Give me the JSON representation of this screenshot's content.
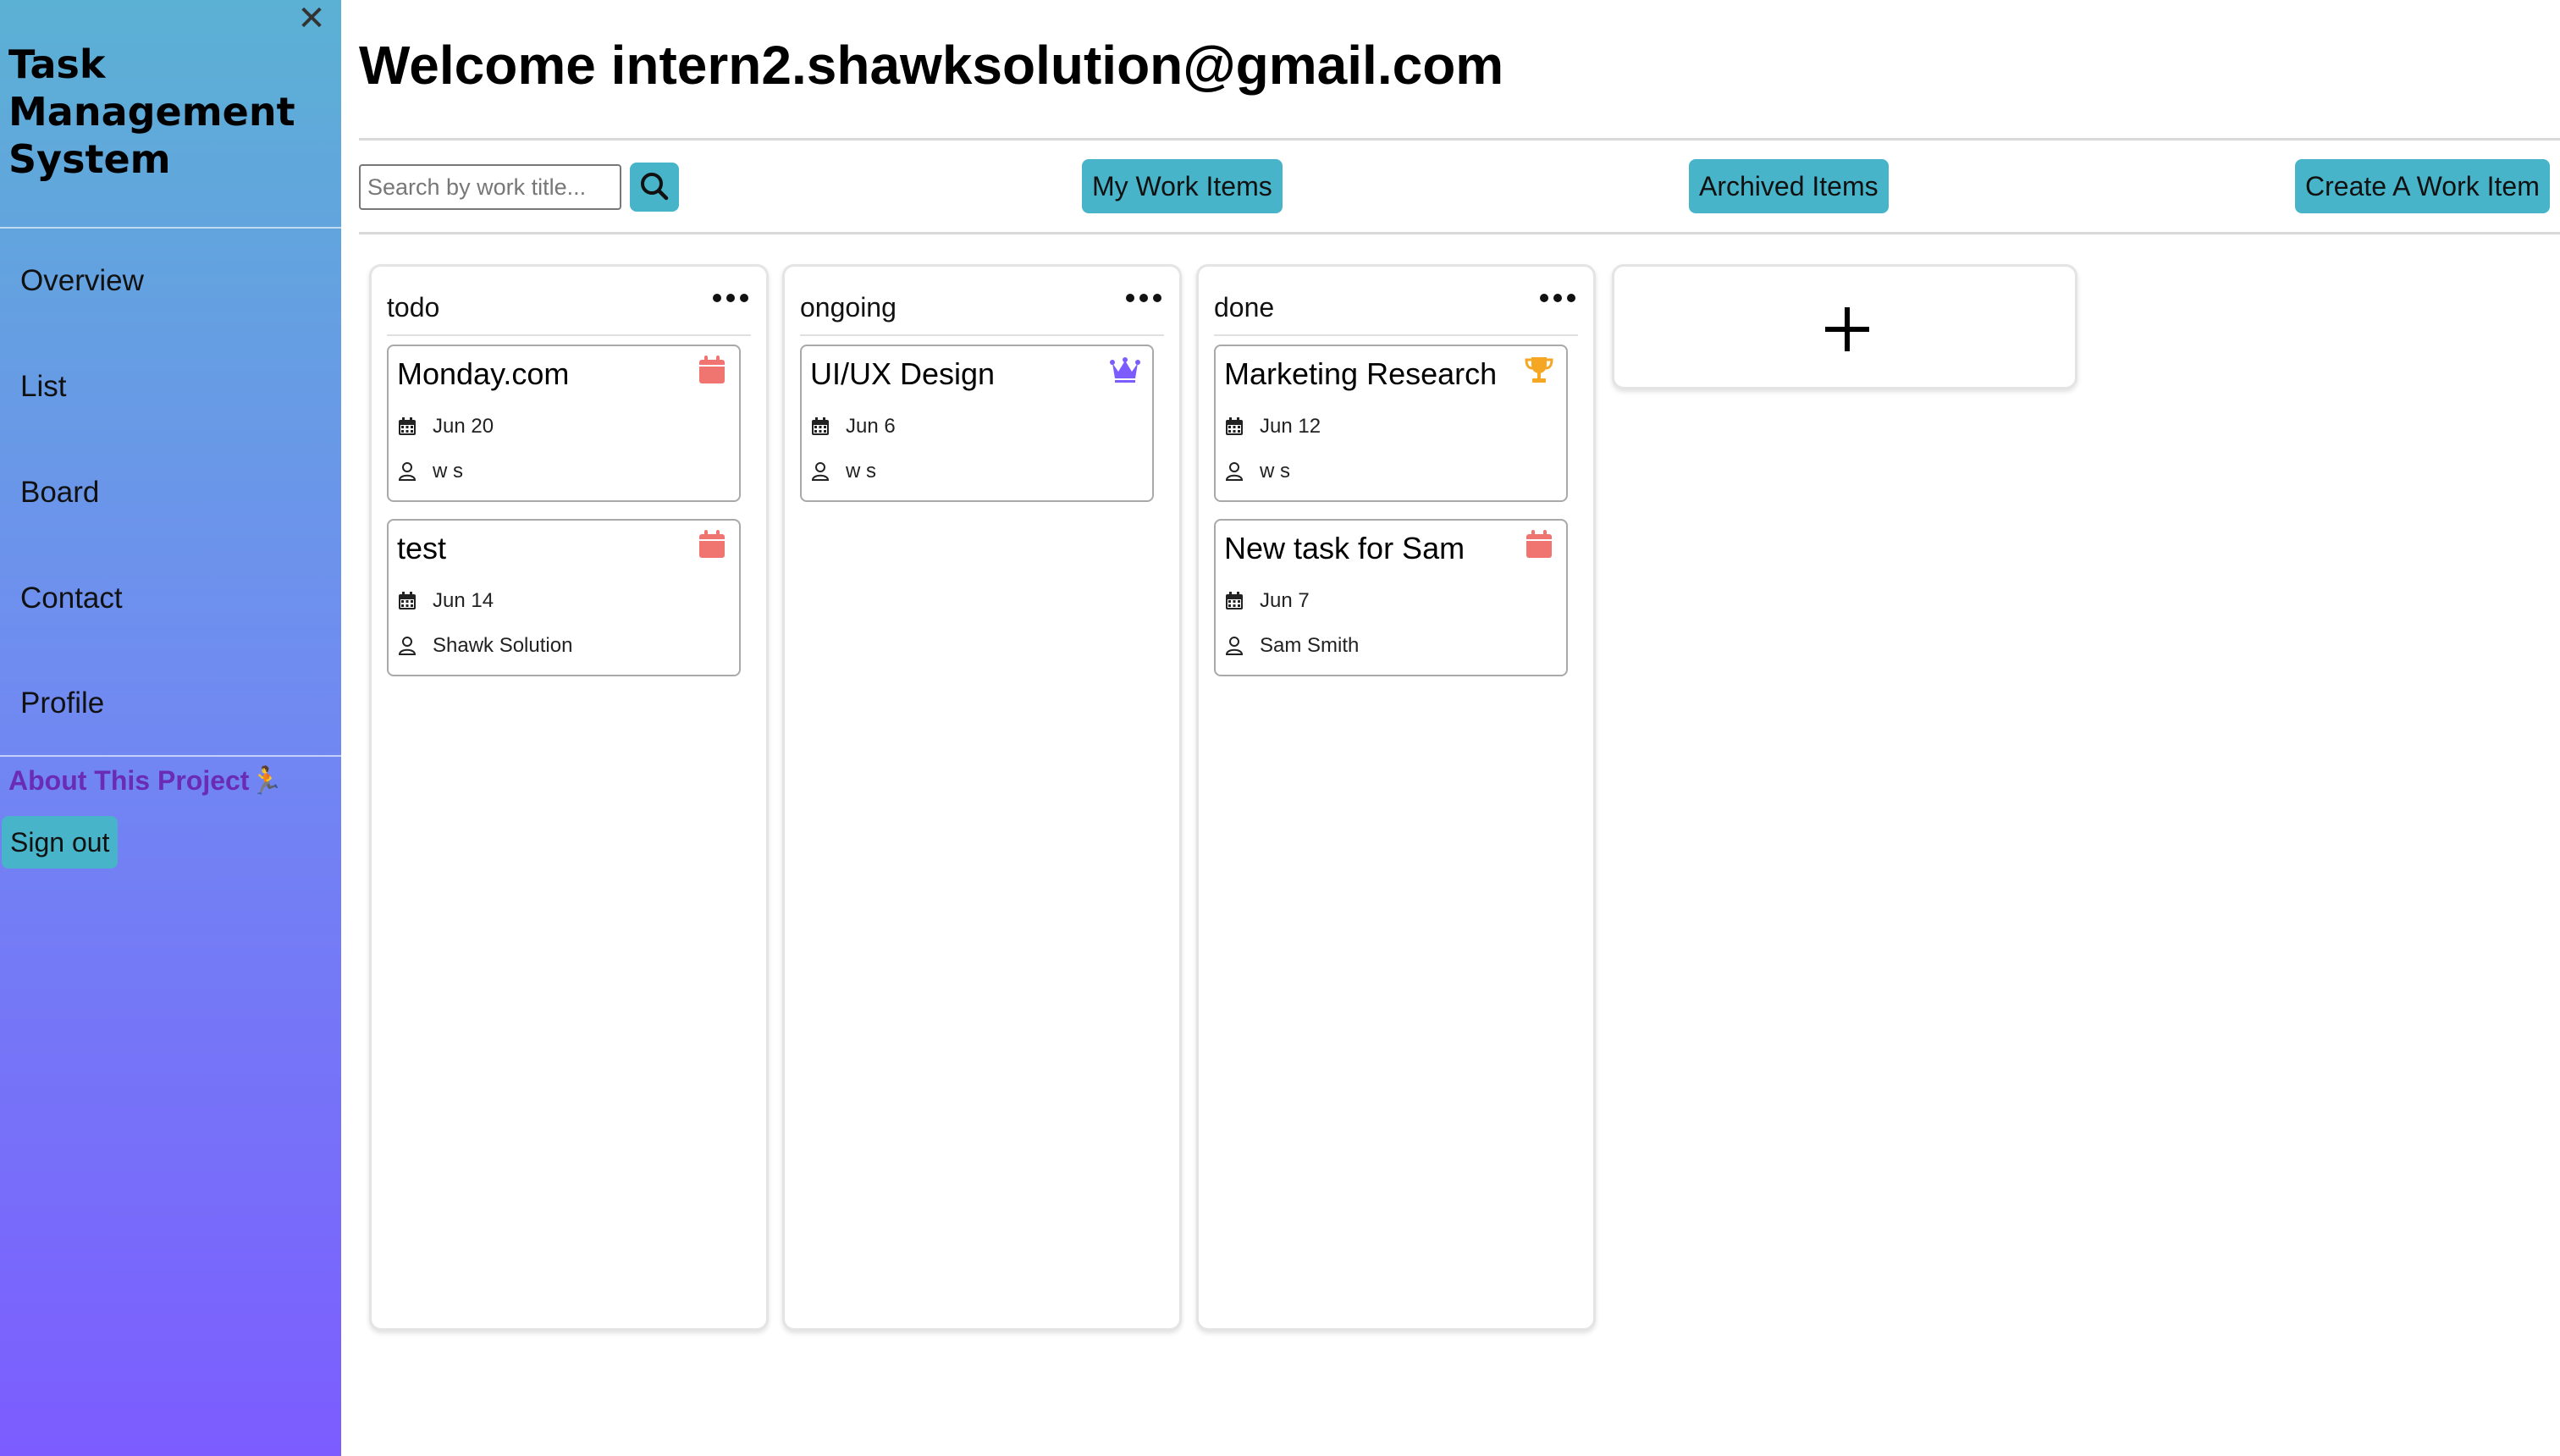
{
  "sidebar": {
    "close_glyph": "✕",
    "title": "Task Management System",
    "nav": [
      {
        "label": "Overview"
      },
      {
        "label": "List"
      },
      {
        "label": "Board"
      },
      {
        "label": "Contact"
      },
      {
        "label": "Profile"
      }
    ],
    "about_label": "About This Project🏃",
    "signout_label": "Sign out"
  },
  "header": {
    "welcome": "Welcome intern2.shawksolution@gmail.com"
  },
  "toolbar": {
    "search_placeholder": "Search by work title...",
    "search_icon": "search-icon",
    "my_work_items": "My Work Items",
    "archived_items": "Archived Items",
    "create_item": "Create A Work Item"
  },
  "board": {
    "columns": [
      {
        "title": "todo",
        "cards": [
          {
            "title": "Monday.com",
            "date": "Jun 20",
            "assignee": "w s",
            "icon": "calendar-icon",
            "icon_color": "#f07470"
          },
          {
            "title": "test",
            "date": "Jun 14",
            "assignee": "Shawk Solution",
            "icon": "calendar-icon",
            "icon_color": "#f07470"
          }
        ]
      },
      {
        "title": "ongoing",
        "cards": [
          {
            "title": "UI/UX Design",
            "date": "Jun 6",
            "assignee": "w s",
            "icon": "crown-icon",
            "icon_color": "#7c5cff"
          }
        ]
      },
      {
        "title": "done",
        "cards": [
          {
            "title": "Marketing Research",
            "date": "Jun 12",
            "assignee": "w s",
            "icon": "trophy-icon",
            "icon_color": "#f5a623"
          },
          {
            "title": "New task for Sam",
            "date": "Jun 7",
            "assignee": "Sam Smith",
            "icon": "calendar-icon",
            "icon_color": "#f07470"
          }
        ]
      }
    ],
    "add_column_glyph": "+"
  },
  "colors": {
    "accent_button": "#48b4c9",
    "sidebar_top": "#5bb1d4",
    "sidebar_bottom": "#7c5cff",
    "about_link": "#6a2bb5"
  }
}
